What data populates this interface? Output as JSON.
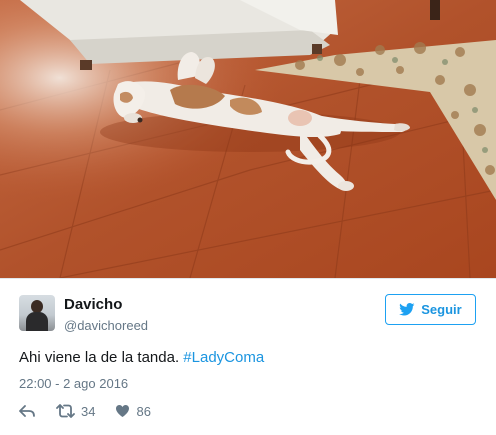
{
  "tweet": {
    "photo_alt_icon": "dog-photo",
    "author": {
      "name": "Davicho",
      "handle": "@davichoreed",
      "avatar_icon": "user-avatar"
    },
    "follow_button": {
      "label": "Seguir",
      "icon": "twitter-bird-icon"
    },
    "text": "Ahi viene la de la tanda. ",
    "hashtag": "#LadyComa",
    "timestamp": "22:00 - 2 ago 2016",
    "actions": {
      "reply_icon": "reply-icon",
      "retweet_icon": "retweet-icon",
      "retweet_count": "34",
      "like_icon": "heart-icon",
      "like_count": "86"
    }
  },
  "colors": {
    "accent": "#1da1f2",
    "link": "#1b95e0",
    "muted": "#657786",
    "text": "#14171a"
  }
}
